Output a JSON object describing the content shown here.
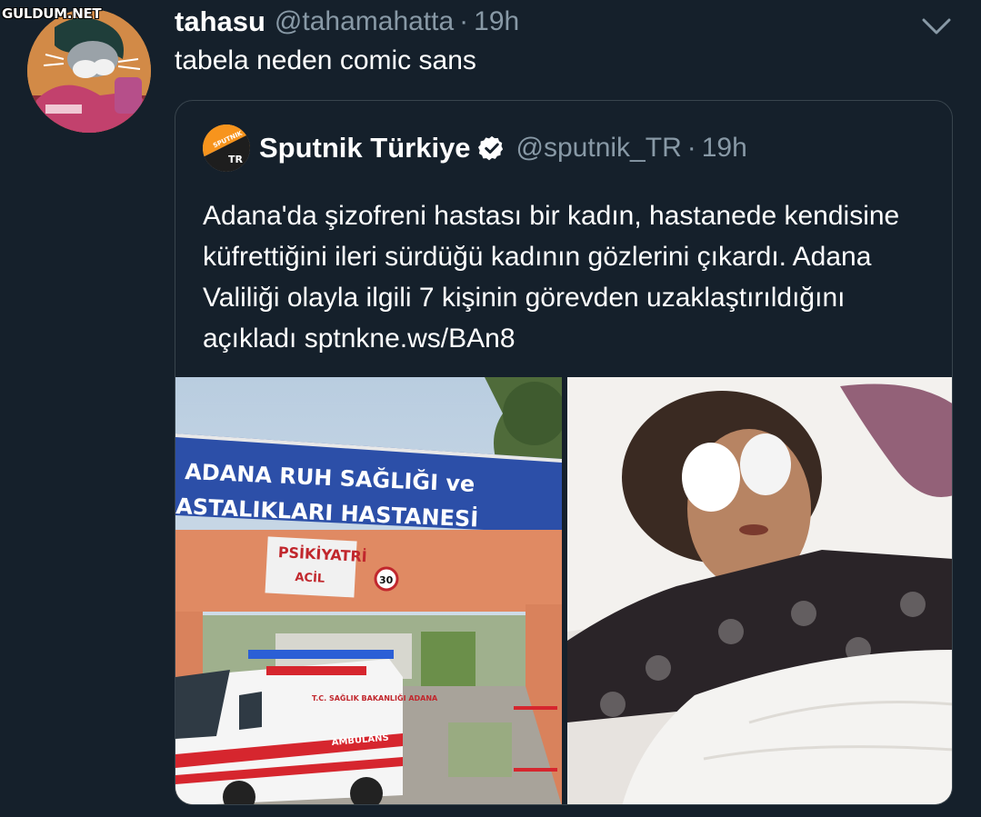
{
  "watermark": "GULDUM.NET",
  "tweet": {
    "display_name": "tahasu",
    "handle": "@tahamahatta",
    "separator": "·",
    "time": "19h",
    "text": "tabela neden comic sans",
    "avatar_icon": "bugs-bunny-avatar"
  },
  "quoted_tweet": {
    "display_name": "Sputnik Türkiye",
    "verified": true,
    "handle": "@sputnik_TR",
    "separator": "·",
    "time": "19h",
    "avatar_logo_top": "SPUTNIK",
    "avatar_logo_bottom": "TR",
    "text": "Adana'da şizofreni hastası bir kadın, hastanede kendisine küfrettiğini ileri sürdüğü kadının gözlerini çıkardı. Adana Valiliği olayla ilgili 7 kişinin görevden uzaklaştırıldığını açıkladı sptnkne.ws/BAn8"
  },
  "media": {
    "photo_1": {
      "sign_line_1": "ADANA RUH SAĞLIĞI ve",
      "sign_line_2": "ASTALIKLARI HASTANESİ",
      "sub_sign": "PSİKİYATRİ",
      "sub_sign_2": "ACİL",
      "speed_sign": "30",
      "ambulance_text": "AMBULANS",
      "ambulance_side": "T.C. SAĞLIK BAKANLIĞI ADANA"
    },
    "photo_2": {
      "description_icon": "patient-photo"
    }
  },
  "colors": {
    "background": "#15202b",
    "muted_text": "#8899a6",
    "border": "#38444d",
    "sputnik_orange": "#f7941d",
    "verified_badge": "#ffffff"
  }
}
